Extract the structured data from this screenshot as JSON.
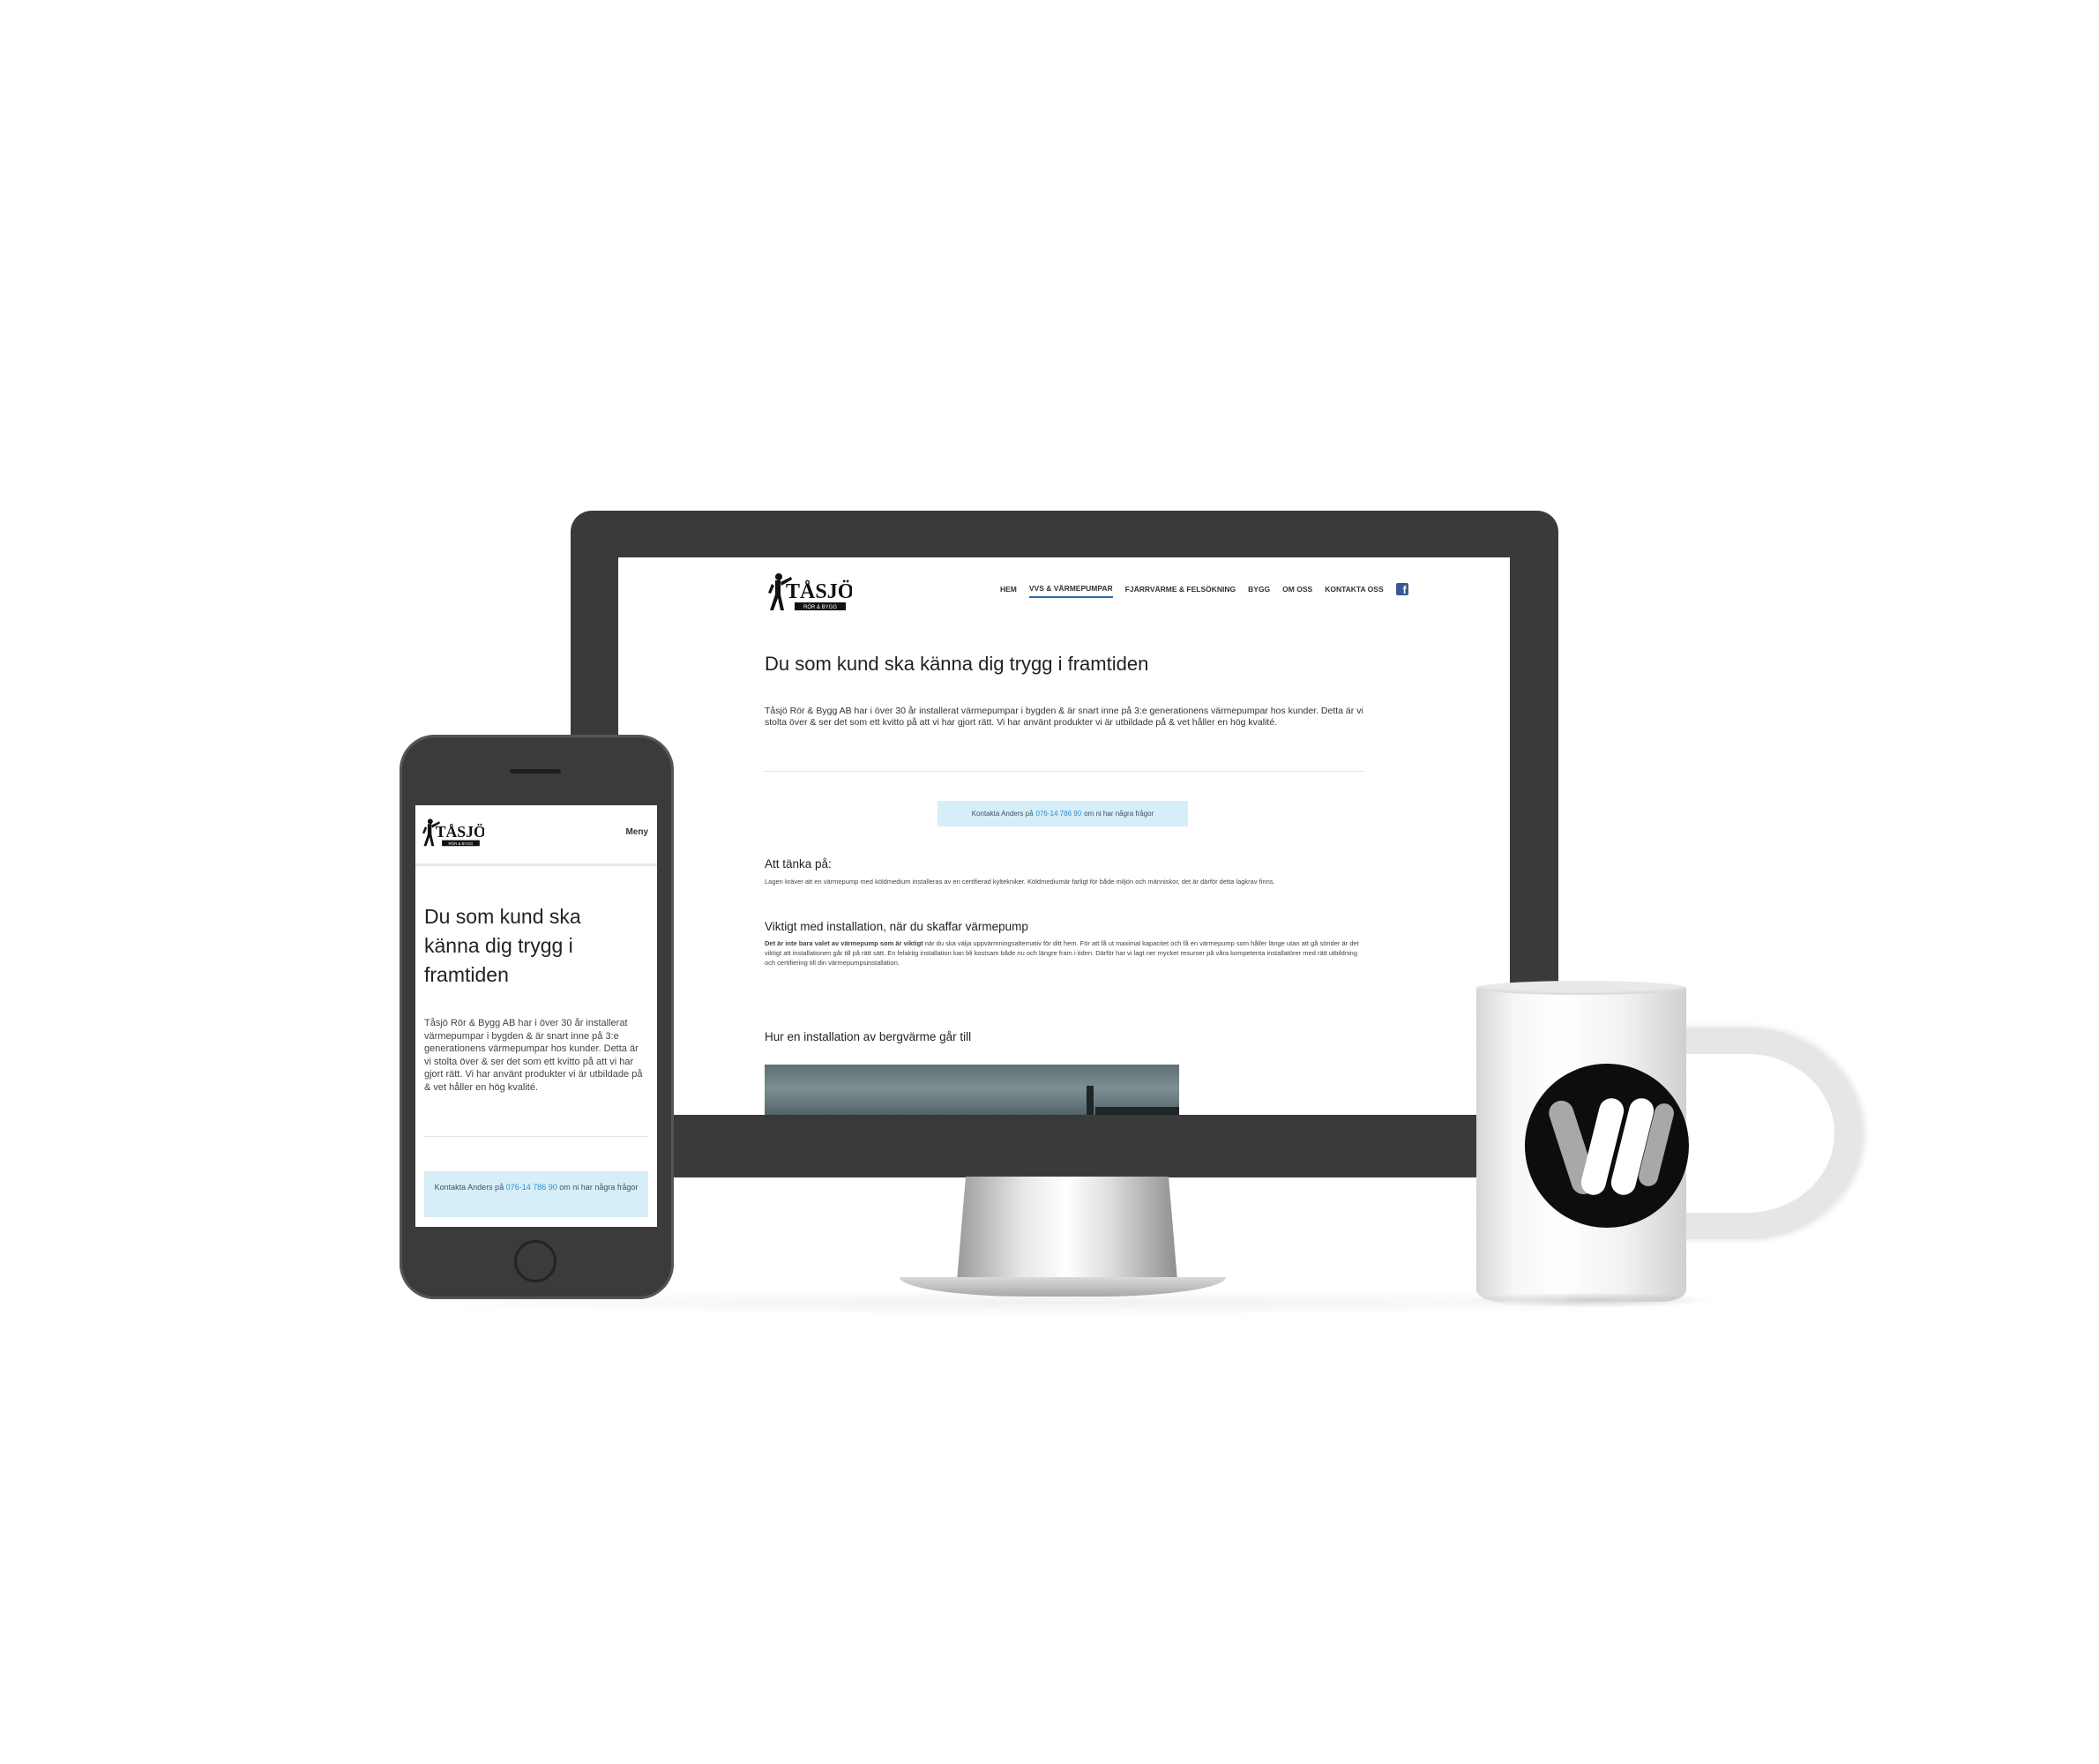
{
  "site": {
    "logo_text": "TÅSJÖ",
    "logo_subtext": "RÖR & BYGG",
    "nav": [
      {
        "label": "HEM",
        "active": false
      },
      {
        "label": "VVS & VÄRMEPUMPAR",
        "active": true
      },
      {
        "label": "FJÄRRVÄRME & FELSÖKNING",
        "active": false
      },
      {
        "label": "BYGG",
        "active": false
      },
      {
        "label": "OM OSS",
        "active": false
      },
      {
        "label": "KONTAKTA OSS",
        "active": false
      }
    ],
    "facebook_icon": "facebook-icon",
    "mobile_menu_label": "Meny",
    "heading": "Du som kund ska känna dig trygg i framtiden",
    "intro": "Tåsjö Rör & Bygg AB har i över 30 år installerat värmepumpar i bygden & är snart inne på 3:e generationens värmepumpar hos kunder. Detta är vi stolta över & ser det som ett kvitto på att vi har gjort rätt. Vi har använt produkter vi är utbildade på & vet håller en hög kvalité.",
    "contact": {
      "prefix": "Kontakta Anders på",
      "phone": "076-14 786 90",
      "suffix": "om ni har några frågor"
    },
    "section1": {
      "title": "Att tänka på:",
      "text": "Lagen kräver att en värmepump med köldmedium installeras av en certifierad kyltekniker. Köldmediumär farligt för både miljön och människor, det är därför detta lagkrav finns."
    },
    "section2": {
      "title": "Viktigt med installation, när du skaffar värmepump",
      "bold": "Det är inte bara valet av värmepump som är viktigt",
      "text": " när du ska välja uppvärmningsalternativ för ditt hem. För att få ut maximal kapacitet och få en värmepump som håller länge utan att gå sönder är det viktigt att installationen går till på rätt sätt. En felaktig installation kan bli kostsam både nu och längre fram i tiden. Därför har vi lagt ner mycket resurser på våra kompetenta installatörer med rätt utbildning och certifiering till din värmepumpsinstallation."
    },
    "section3": {
      "title": "Hur en installation av bergvärme går till"
    }
  },
  "colors": {
    "accent": "#2b6cb0",
    "link": "#2b8fd0",
    "contact_bg": "#d6eef7",
    "device_frame": "#3a3a3a",
    "facebook": "#3b5998"
  },
  "mug": {
    "logo_icon": "brand-circle-logo"
  }
}
